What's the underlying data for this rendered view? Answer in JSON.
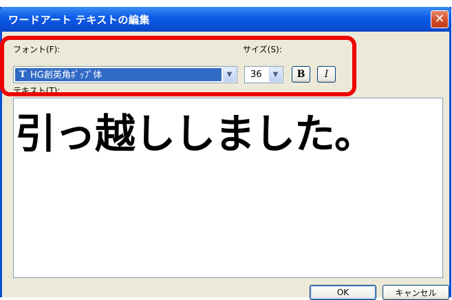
{
  "window": {
    "title": "ワードアート テキストの編集",
    "close_glyph": "✕"
  },
  "font": {
    "label": "フォント(F):",
    "icon": "truetype-font-icon",
    "icon_glyph": "T",
    "value": "HG創英角ﾎﾟｯﾌﾟ体",
    "dropdown_glyph": "▼"
  },
  "size": {
    "label": "サイズ(S):",
    "value": "36",
    "dropdown_glyph": "▼"
  },
  "bold": {
    "label": "B"
  },
  "italic": {
    "label": "I"
  },
  "text": {
    "label": "テキスト(T):",
    "value": "引っ越ししました。"
  },
  "buttons": {
    "ok": "OK",
    "cancel": "キャンセル"
  },
  "colors": {
    "highlight": "#ee0000",
    "selection": "#316ac5",
    "title_bar": "#0a50d8"
  }
}
